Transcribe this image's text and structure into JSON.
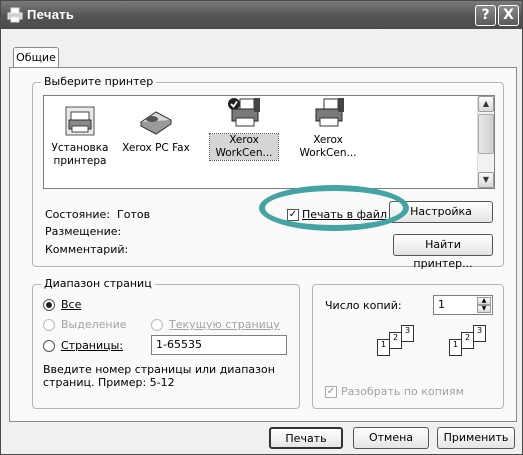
{
  "window": {
    "title": "Печать",
    "help_glyph": "?",
    "close_glyph": "X"
  },
  "tabs": [
    {
      "label": "Общие",
      "selected": true
    }
  ],
  "printer_group": {
    "label": "Выберите принтер",
    "printers": [
      {
        "line1": "Установка",
        "line2": "принтера",
        "icon": "add-printer-icon"
      },
      {
        "line1": "Xerox PC Fax",
        "line2": "",
        "icon": "fax-icon"
      },
      {
        "line1": "Xerox",
        "line2": "WorkCen...",
        "icon": "default-printer-icon",
        "selected": true
      },
      {
        "line1": "Xerox",
        "line2": "WorkCen...",
        "icon": "printer-icon"
      }
    ],
    "status_label": "Состояние:",
    "status_value": "Готов",
    "location_label": "Размещение:",
    "comment_label": "Комментарий:",
    "print_to_file_label": "Печать в файл",
    "print_to_file_checked": true,
    "settings_button": "Настройка",
    "find_printer_button": "Найти принтер..."
  },
  "range_group": {
    "label": "Диапазон страниц",
    "all_label": "Все",
    "selection_label": "Выделение",
    "current_page_label": "Текущую страницу",
    "pages_label": "Страницы:",
    "pages_value": "1-65535",
    "hint": "Введите номер страницы или диапазон страниц.  Пример: 5-12",
    "selected_option": "all"
  },
  "copies_group": {
    "copies_label": "Число копий:",
    "copies_value": "1",
    "collate_label": "Разобрать по копиям",
    "collate_checked": true,
    "collate_enabled": false
  },
  "buttons": {
    "print": "Печать",
    "cancel": "Отмена",
    "apply": "Применить"
  },
  "colors": {
    "annotation_circle": "#45a3a3",
    "titlebar": "#5a5a5a"
  }
}
